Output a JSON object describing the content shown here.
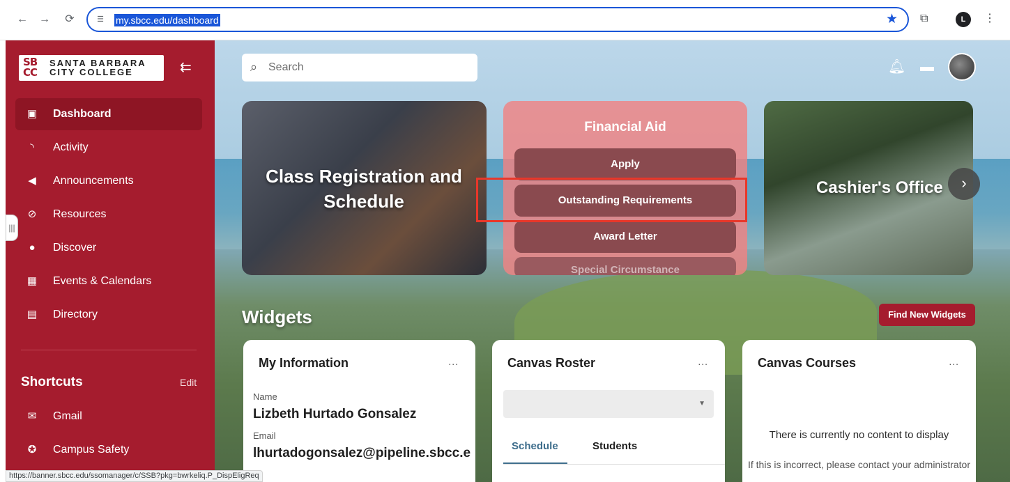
{
  "browser": {
    "url": "my.sbcc.edu/dashboard",
    "back_icon": "arrow-left",
    "forward_icon": "arrow-right",
    "reload_icon": "reload",
    "profile_initial": "L",
    "status_url": "https://banner.sbcc.edu/ssomanager/c/SSB?pkg=bwrkeliq.P_DispEligReq",
    "highlight_color": "#1a56d8"
  },
  "sidebar": {
    "logo_mark": "SB\nCC",
    "logo_line1": "SANTA BARBARA",
    "logo_line2": "CITY COLLEGE",
    "items": [
      {
        "label": "Dashboard",
        "icon": "monitor-icon",
        "active": true
      },
      {
        "label": "Activity",
        "icon": "rss-icon"
      },
      {
        "label": "Announcements",
        "icon": "megaphone-icon"
      },
      {
        "label": "Resources",
        "icon": "paperclip-icon"
      },
      {
        "label": "Discover",
        "icon": "compass-icon"
      },
      {
        "label": "Events & Calendars",
        "icon": "calendar-star-icon"
      },
      {
        "label": "Directory",
        "icon": "address-book-icon"
      }
    ],
    "shortcuts_title": "Shortcuts",
    "shortcuts_edit": "Edit",
    "shortcuts": [
      {
        "label": "Gmail",
        "icon": "mail-icon"
      },
      {
        "label": "Campus Safety",
        "icon": "badge-icon"
      }
    ],
    "brand_color": "#a51c2e"
  },
  "header": {
    "search_placeholder": "Search"
  },
  "cards": {
    "registration_title": "Class Registration and Schedule",
    "financial_aid": {
      "title": "Financial Aid",
      "buttons": [
        "Apply",
        "Outstanding Requirements",
        "Award Letter",
        "Special Circumstance"
      ]
    },
    "cashier_title": "Cashier's Office"
  },
  "widgets_section": {
    "title": "Widgets",
    "find_button": "Find New Widgets"
  },
  "my_information": {
    "title": "My Information",
    "more": "...",
    "name_label": "Name",
    "name_value": "Lizbeth Hurtado Gonsalez",
    "email_label": "Email",
    "email_value": "lhurtadogonsalez@pipeline.sbcc.e"
  },
  "canvas_roster": {
    "title": "Canvas Roster",
    "more": "...",
    "tabs": [
      "Schedule",
      "Students"
    ]
  },
  "canvas_courses": {
    "title": "Canvas Courses",
    "more": "...",
    "empty_message": "There is currently no content to display",
    "empty_sub": "If this is incorrect, please contact your administrator"
  }
}
